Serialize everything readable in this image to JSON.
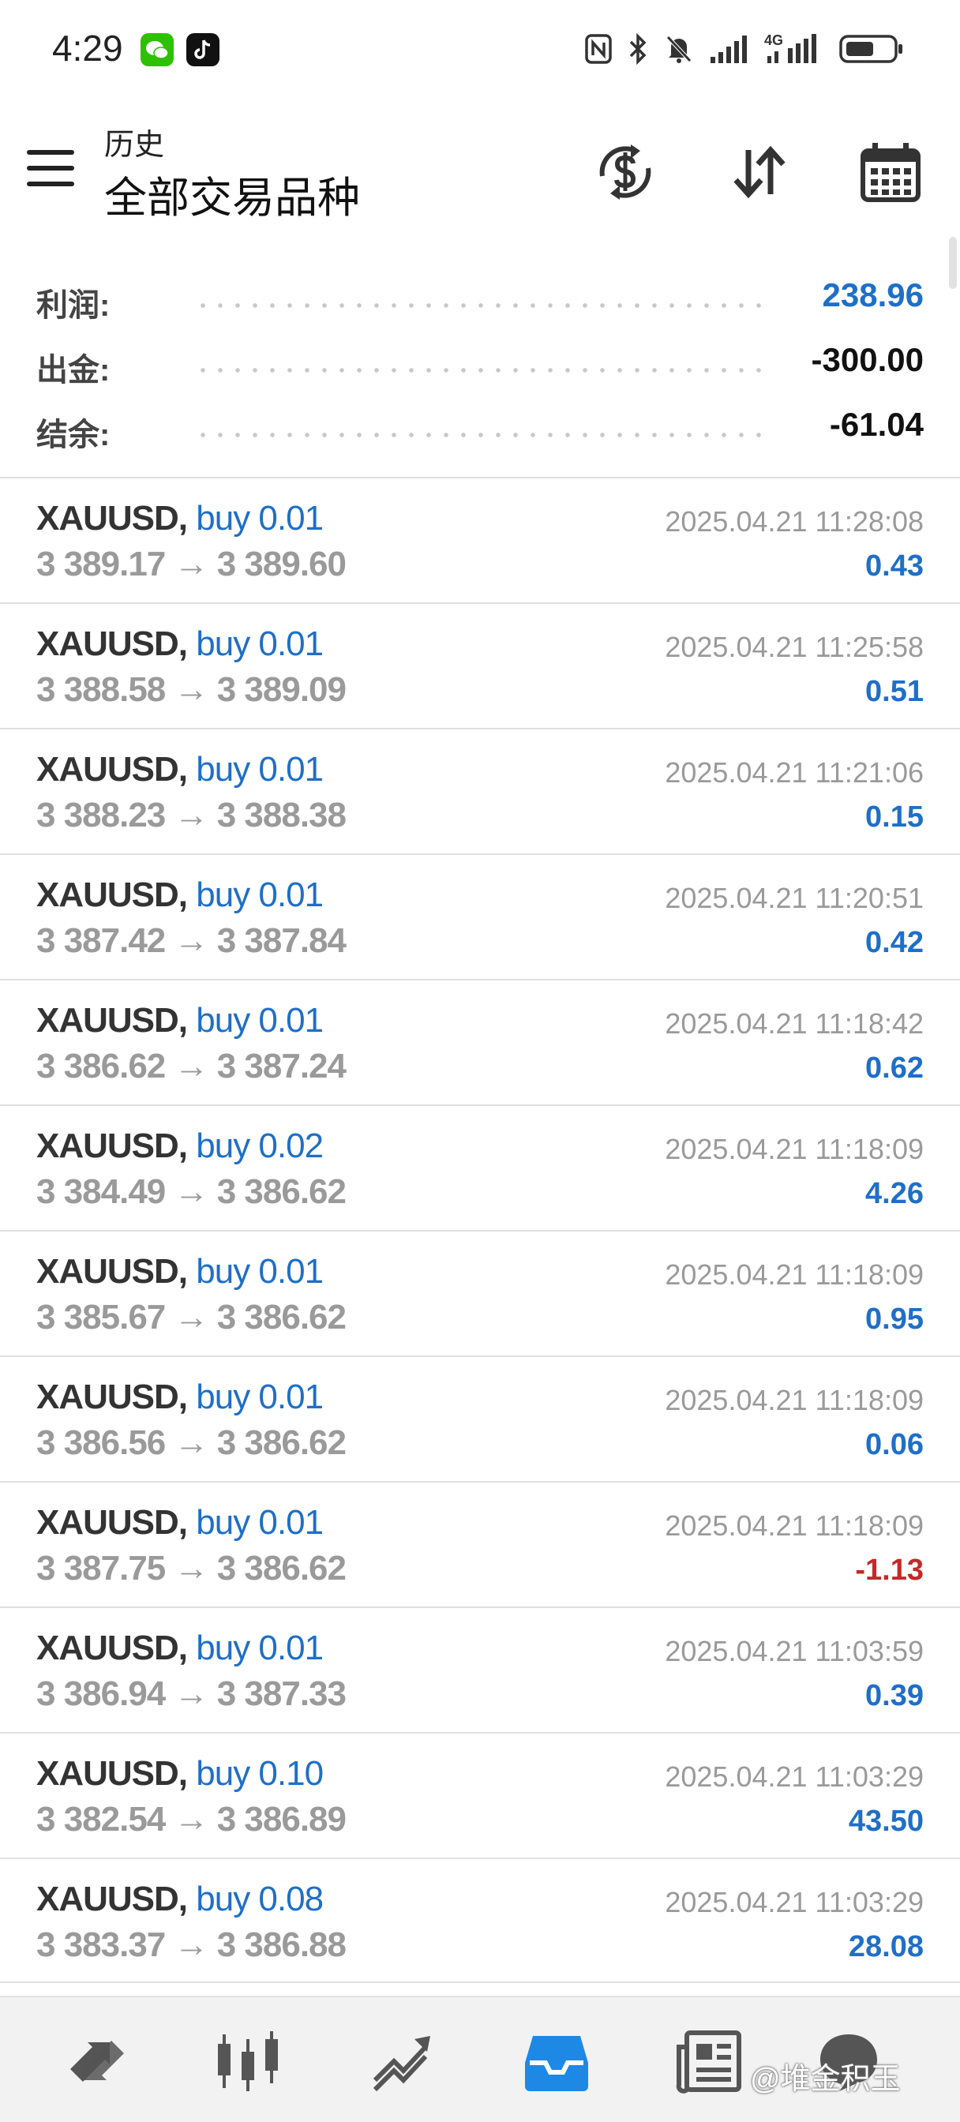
{
  "status_bar": {
    "time": "4:29",
    "network_label": "4G",
    "icons": [
      "wechat-icon",
      "tiktok-icon",
      "nfc-icon",
      "bluetooth-icon",
      "mute-icon",
      "signal-icon",
      "signal-4g-icon",
      "battery-icon"
    ]
  },
  "header": {
    "subtitle": "历史",
    "title": "全部交易品种",
    "actions": [
      "dollar-exchange-icon",
      "sort-icon",
      "calendar-icon"
    ]
  },
  "summary": {
    "rows": [
      {
        "label": "利润:",
        "value": "238.96",
        "color": "#1e6fc8"
      },
      {
        "label": "出金:",
        "value": "-300.00",
        "color": "#111111"
      },
      {
        "label": "结余:",
        "value": "-61.04",
        "color": "#111111"
      }
    ]
  },
  "trades": [
    {
      "symbol": "XAUUSD,",
      "side": "buy 0.01",
      "prices": "3 389.17 → 3 389.60",
      "time": "2025.04.21 11:28:08",
      "profit": "0.43"
    },
    {
      "symbol": "XAUUSD,",
      "side": "buy 0.01",
      "prices": "3 388.58 → 3 389.09",
      "time": "2025.04.21 11:25:58",
      "profit": "0.51"
    },
    {
      "symbol": "XAUUSD,",
      "side": "buy 0.01",
      "prices": "3 388.23 → 3 388.38",
      "time": "2025.04.21 11:21:06",
      "profit": "0.15"
    },
    {
      "symbol": "XAUUSD,",
      "side": "buy 0.01",
      "prices": "3 387.42 → 3 387.84",
      "time": "2025.04.21 11:20:51",
      "profit": "0.42"
    },
    {
      "symbol": "XAUUSD,",
      "side": "buy 0.01",
      "prices": "3 386.62 → 3 387.24",
      "time": "2025.04.21 11:18:42",
      "profit": "0.62"
    },
    {
      "symbol": "XAUUSD,",
      "side": "buy 0.02",
      "prices": "3 384.49 → 3 386.62",
      "time": "2025.04.21 11:18:09",
      "profit": "4.26"
    },
    {
      "symbol": "XAUUSD,",
      "side": "buy 0.01",
      "prices": "3 385.67 → 3 386.62",
      "time": "2025.04.21 11:18:09",
      "profit": "0.95"
    },
    {
      "symbol": "XAUUSD,",
      "side": "buy 0.01",
      "prices": "3 386.56 → 3 386.62",
      "time": "2025.04.21 11:18:09",
      "profit": "0.06"
    },
    {
      "symbol": "XAUUSD,",
      "side": "buy 0.01",
      "prices": "3 387.75 → 3 386.62",
      "time": "2025.04.21 11:18:09",
      "profit": "-1.13"
    },
    {
      "symbol": "XAUUSD,",
      "side": "buy 0.01",
      "prices": "3 386.94 → 3 387.33",
      "time": "2025.04.21 11:03:59",
      "profit": "0.39"
    },
    {
      "symbol": "XAUUSD,",
      "side": "buy 0.10",
      "prices": "3 382.54 → 3 386.89",
      "time": "2025.04.21 11:03:29",
      "profit": "43.50"
    },
    {
      "symbol": "XAUUSD,",
      "side": "buy 0.08",
      "prices": "3 383.37 → 3 386.88",
      "time": "2025.04.21 11:03:29",
      "profit": "28.08"
    }
  ],
  "bottom_nav": {
    "items": [
      "quotes-icon",
      "chart-icon",
      "trade-icon",
      "history-icon",
      "news-icon",
      "chat-icon"
    ],
    "active": "history-icon",
    "active_color": "#1e88e5",
    "watermark": "@堆金积玉"
  },
  "colors": {
    "positive": "#1e6fc8",
    "negative": "#c62828",
    "muted": "#9a9a9a"
  }
}
